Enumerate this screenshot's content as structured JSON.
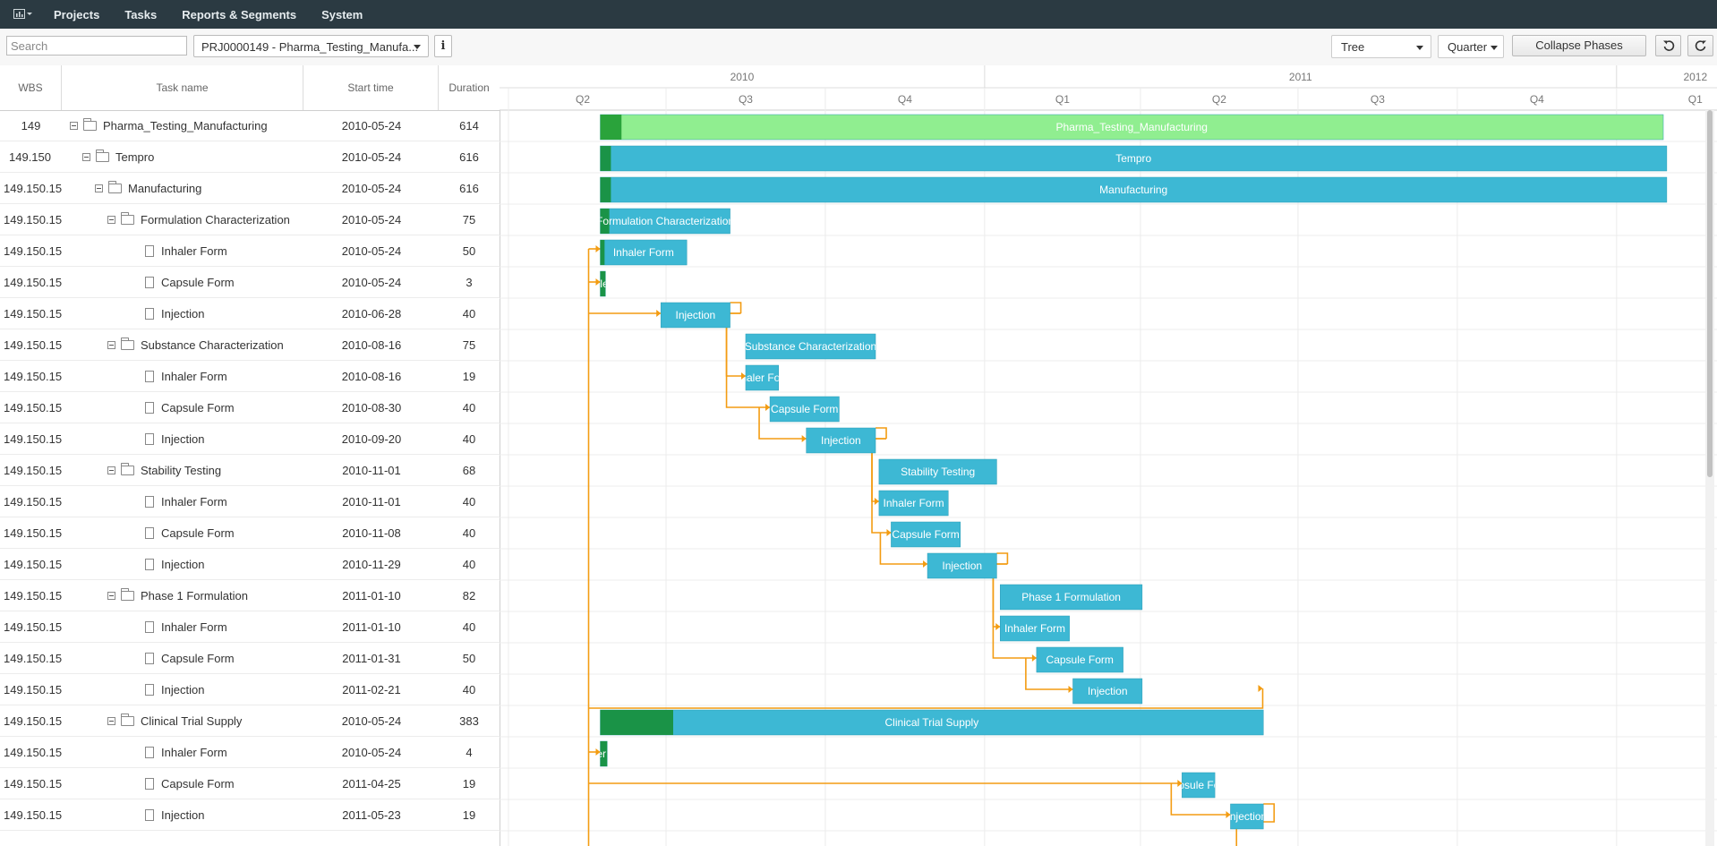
{
  "nav": {
    "app_icon": "chart-icon",
    "items": [
      "Projects",
      "Tasks",
      "Reports & Segments",
      "System"
    ]
  },
  "toolbar": {
    "search_placeholder": "Search",
    "project": "PRJ0000149 - Pharma_Testing_Manufa...",
    "info_label": "i",
    "view_mode": "Tree",
    "scale": "Quarter",
    "collapse_label": "Collapse Phases",
    "undo_icon": "undo-icon",
    "redo_icon": "redo-icon"
  },
  "grid": {
    "headers": {
      "wbs": "WBS",
      "task": "Task name",
      "start": "Start time",
      "duration": "Duration"
    },
    "rows": [
      {
        "wbs": "149",
        "name": "Pharma_Testing_Manufacturing",
        "start": "2010-05-24",
        "duration": "614",
        "level": 0,
        "type": "folder"
      },
      {
        "wbs": "149.150",
        "name": "Tempro",
        "start": "2010-05-24",
        "duration": "616",
        "level": 1,
        "type": "folder"
      },
      {
        "wbs": "149.150.15",
        "name": "Manufacturing",
        "start": "2010-05-24",
        "duration": "616",
        "level": 2,
        "type": "folder"
      },
      {
        "wbs": "149.150.15",
        "name": "Formulation Characterization",
        "start": "2010-05-24",
        "duration": "75",
        "level": 3,
        "type": "folder"
      },
      {
        "wbs": "149.150.15",
        "name": "Inhaler Form",
        "start": "2010-05-24",
        "duration": "50",
        "level": 4,
        "type": "task"
      },
      {
        "wbs": "149.150.15",
        "name": "Capsule Form",
        "start": "2010-05-24",
        "duration": "3",
        "level": 4,
        "type": "task"
      },
      {
        "wbs": "149.150.15",
        "name": "Injection",
        "start": "2010-06-28",
        "duration": "40",
        "level": 4,
        "type": "task"
      },
      {
        "wbs": "149.150.15",
        "name": "Substance Characterization",
        "start": "2010-08-16",
        "duration": "75",
        "level": 3,
        "type": "folder"
      },
      {
        "wbs": "149.150.15",
        "name": "Inhaler Form",
        "start": "2010-08-16",
        "duration": "19",
        "level": 4,
        "type": "task"
      },
      {
        "wbs": "149.150.15",
        "name": "Capsule Form",
        "start": "2010-08-30",
        "duration": "40",
        "level": 4,
        "type": "task"
      },
      {
        "wbs": "149.150.15",
        "name": "Injection",
        "start": "2010-09-20",
        "duration": "40",
        "level": 4,
        "type": "task"
      },
      {
        "wbs": "149.150.15",
        "name": "Stability Testing",
        "start": "2010-11-01",
        "duration": "68",
        "level": 3,
        "type": "folder"
      },
      {
        "wbs": "149.150.15",
        "name": "Inhaler Form",
        "start": "2010-11-01",
        "duration": "40",
        "level": 4,
        "type": "task"
      },
      {
        "wbs": "149.150.15",
        "name": "Capsule Form",
        "start": "2010-11-08",
        "duration": "40",
        "level": 4,
        "type": "task"
      },
      {
        "wbs": "149.150.15",
        "name": "Injection",
        "start": "2010-11-29",
        "duration": "40",
        "level": 4,
        "type": "task"
      },
      {
        "wbs": "149.150.15",
        "name": "Phase 1 Formulation",
        "start": "2011-01-10",
        "duration": "82",
        "level": 3,
        "type": "folder"
      },
      {
        "wbs": "149.150.15",
        "name": "Inhaler Form",
        "start": "2011-01-10",
        "duration": "40",
        "level": 4,
        "type": "task"
      },
      {
        "wbs": "149.150.15",
        "name": "Capsule Form",
        "start": "2011-01-31",
        "duration": "50",
        "level": 4,
        "type": "task"
      },
      {
        "wbs": "149.150.15",
        "name": "Injection",
        "start": "2011-02-21",
        "duration": "40",
        "level": 4,
        "type": "task"
      },
      {
        "wbs": "149.150.15",
        "name": "Clinical Trial Supply",
        "start": "2010-05-24",
        "duration": "383",
        "level": 3,
        "type": "folder"
      },
      {
        "wbs": "149.150.15",
        "name": "Inhaler Form",
        "start": "2010-05-24",
        "duration": "4",
        "level": 4,
        "type": "task"
      },
      {
        "wbs": "149.150.15",
        "name": "Capsule Form",
        "start": "2011-04-25",
        "duration": "19",
        "level": 4,
        "type": "task"
      },
      {
        "wbs": "149.150.15",
        "name": "Injection",
        "start": "2011-05-23",
        "duration": "19",
        "level": 4,
        "type": "task"
      }
    ]
  },
  "timeline": {
    "years": [
      "2010",
      "2011",
      "2012"
    ],
    "quarters": [
      "Q2",
      "Q3",
      "Q4",
      "Q1",
      "Q2",
      "Q3",
      "Q4",
      "Q1"
    ]
  },
  "gantt": {
    "bars": [
      {
        "label": "Pharma_Testing_Manufacturing",
        "color": "#90ee90",
        "progress_color": "#2aa33b",
        "progress": 0.02
      },
      {
        "label": "Tempro",
        "color": "#3db8d4",
        "progress_color": "#1a9347",
        "progress": 0.01
      },
      {
        "label": "Manufacturing",
        "color": "#3db8d4",
        "progress_color": "#1a9347",
        "progress": 0.01
      },
      {
        "label": "Formulation Characterization",
        "color": "#3db8d4",
        "progress_color": "#1a9347",
        "progress": 0.07
      },
      {
        "label": "Inhaler Form",
        "color": "#3db8d4",
        "progress_color": "#1a9347",
        "progress": 0.05
      },
      {
        "label": "Capsule Form",
        "color": "#3db8d4",
        "progress_color": "#1a9347",
        "progress": 1.0
      },
      {
        "label": "Injection",
        "color": "#3db8d4",
        "progress_color": "#1a9347",
        "progress": 0
      },
      {
        "label": "Substance Characterization",
        "color": "#3db8d4",
        "progress_color": "#1a9347",
        "progress": 0
      },
      {
        "label": "Inhaler Form",
        "color": "#3db8d4",
        "progress_color": "#1a9347",
        "progress": 0
      },
      {
        "label": "Capsule Form",
        "color": "#3db8d4",
        "progress_color": "#1a9347",
        "progress": 0
      },
      {
        "label": "Injection",
        "color": "#3db8d4",
        "progress_color": "#1a9347",
        "progress": 0
      },
      {
        "label": "Stability Testing",
        "color": "#3db8d4",
        "progress_color": "#1a9347",
        "progress": 0
      },
      {
        "label": "Inhaler Form",
        "color": "#3db8d4",
        "progress_color": "#1a9347",
        "progress": 0
      },
      {
        "label": "Capsule Form",
        "color": "#3db8d4",
        "progress_color": "#1a9347",
        "progress": 0
      },
      {
        "label": "Injection",
        "color": "#3db8d4",
        "progress_color": "#1a9347",
        "progress": 0
      },
      {
        "label": "Phase 1 Formulation",
        "color": "#3db8d4",
        "progress_color": "#1a9347",
        "progress": 0
      },
      {
        "label": "Inhaler Form",
        "color": "#3db8d4",
        "progress_color": "#1a9347",
        "progress": 0
      },
      {
        "label": "Capsule Form",
        "color": "#3db8d4",
        "progress_color": "#1a9347",
        "progress": 0
      },
      {
        "label": "Injection",
        "color": "#3db8d4",
        "progress_color": "#1a9347",
        "progress": 0
      },
      {
        "label": "Clinical Trial Supply",
        "color": "#3db8d4",
        "progress_color": "#1a9347",
        "progress": 0.11
      },
      {
        "label": "Inhaler Form",
        "color": "#3db8d4",
        "progress_color": "#1a9347",
        "progress": 1.0
      },
      {
        "label": "Capsule Form",
        "color": "#3db8d4",
        "progress_color": "#1a9347",
        "progress": 0
      },
      {
        "label": "Injection",
        "color": "#3db8d4",
        "progress_color": "#1a9347",
        "progress": 0
      }
    ],
    "link_color": "#f39c12",
    "grid_color": "#ececec"
  }
}
